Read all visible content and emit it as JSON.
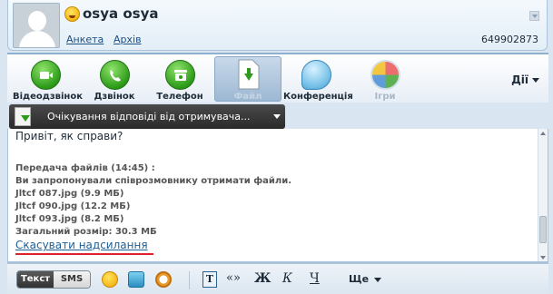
{
  "contact": {
    "name": "osya osya",
    "profile_link": "Анкета",
    "archive_link": "Архів",
    "uin": "649902873"
  },
  "toolbar": {
    "items": [
      {
        "label": "Відеодзвінок",
        "icon": "video-camera-icon"
      },
      {
        "label": "Дзвінок",
        "icon": "phone-handset-icon"
      },
      {
        "label": "Телефон",
        "icon": "telephone-icon"
      },
      {
        "label": "Файл",
        "icon": "file-transfer-icon",
        "state": "active-disabled"
      },
      {
        "label": "Конференція",
        "icon": "conference-bubbles-icon"
      },
      {
        "label": "Ігри",
        "icon": "games-icon",
        "state": "disabled"
      }
    ],
    "actions_label": "Дії"
  },
  "notification": {
    "text": "Очікування відповіді від отримувача..."
  },
  "messages": {
    "greeting": "Привіт, як справи?",
    "transfer_header": "Передача файлів (14:45) :",
    "transfer_offer": "Ви запропонували співрозмовнику отримати файли.",
    "files": [
      "Jltcf 087.jpg (9.9 МБ)",
      "Jltcf 090.jpg (12.2 МБ)",
      "Jltcf 093.jpg (8.2 МБ)"
    ],
    "total": "Загальний розмір: 30.3 МБ",
    "cancel_link": "Скасувати надсилання"
  },
  "input_bar": {
    "text_mode": "Текст",
    "sms_mode": "SMS",
    "format_letter": "T",
    "quotes": "«»",
    "bold": "Ж",
    "italic": "К",
    "underline": "Ч",
    "more_label": "Ще"
  },
  "colors": {
    "accent_link": "#1d5f96",
    "highlight_underline": "#e0202a",
    "header_bg": "#e3eef7"
  }
}
